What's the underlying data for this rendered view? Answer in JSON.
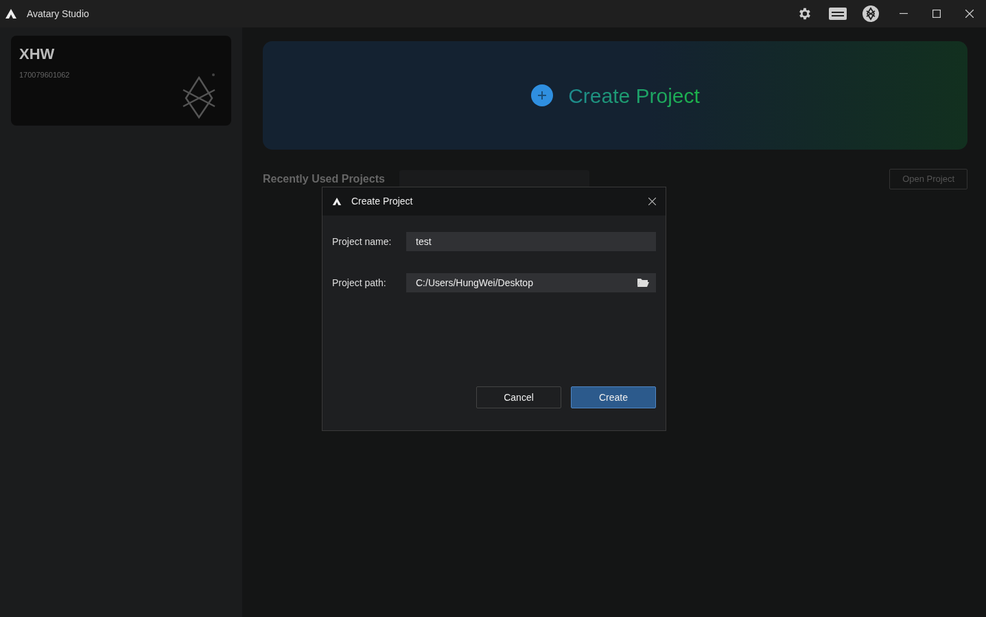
{
  "window": {
    "title": "Avatary Studio"
  },
  "account": {
    "name": "XHW",
    "id": "170079601062"
  },
  "banner": {
    "label": "Create Project"
  },
  "recent": {
    "heading": "Recently Used Projects",
    "open_button": "Open Project"
  },
  "dialog": {
    "title": "Create Project",
    "fields": [
      {
        "label": "Project name:",
        "value": "test",
        "kind": "text"
      },
      {
        "label": "Project path:",
        "value": "C:/Users/HungWei/Desktop",
        "kind": "path"
      }
    ],
    "buttons": [
      {
        "label": "Cancel",
        "kind": "secondary"
      },
      {
        "label": "Create",
        "kind": "primary"
      }
    ]
  }
}
